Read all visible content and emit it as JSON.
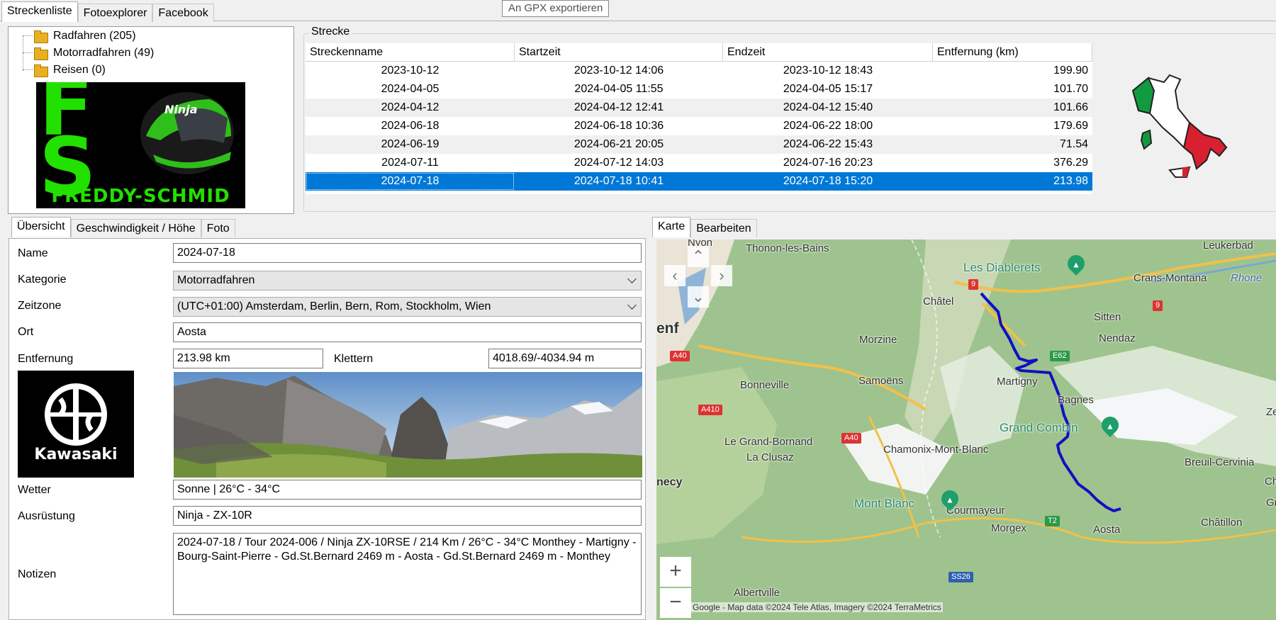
{
  "top_tabs": [
    "Streckenliste",
    "Fotoexplorer",
    "Facebook"
  ],
  "tooltip": "An GPX exportieren",
  "tree": [
    "Radfahren (205)",
    "Motorradfahren (49)",
    "Reisen (0)"
  ],
  "logo": {
    "letters": "FS",
    "name": "FREDDY-SCHMID",
    "brand_color": "#22e000"
  },
  "routes": {
    "group_title": "Strecke",
    "columns": [
      "Streckenname",
      "Startzeit",
      "Endzeit",
      "Entfernung (km)"
    ],
    "rows": [
      [
        "2023-10-12",
        "2023-10-12 14:06",
        "2023-10-12 18:43",
        "199.90"
      ],
      [
        "2024-04-05",
        "2024-04-05 11:55",
        "2024-04-05 15:17",
        "101.70"
      ],
      [
        "2024-04-12",
        "2024-04-12 12:41",
        "2024-04-12 15:40",
        "101.66"
      ],
      [
        "2024-06-18",
        "2024-06-18 10:36",
        "2024-06-22 18:00",
        "179.69"
      ],
      [
        "2024-06-19",
        "2024-06-21 20:05",
        "2024-06-22 15:43",
        "71.54"
      ],
      [
        "2024-07-11",
        "2024-07-12 14:03",
        "2024-07-16 20:23",
        "376.29"
      ],
      [
        "2024-07-18",
        "2024-07-18 10:41",
        "2024-07-18 15:20",
        "213.98"
      ]
    ],
    "selected_row": 6,
    "selection_color": "#0078d7"
  },
  "detail_tabs": [
    "Übersicht",
    "Geschwindigkeit / Höhe",
    "Foto"
  ],
  "detail": {
    "name_label": "Name",
    "name": "2024-07-18",
    "category_label": "Kategorie",
    "category": "Motorradfahren",
    "timezone_label": "Zeitzone",
    "timezone": "(UTC+01:00) Amsterdam, Berlin, Bern, Rom, Stockholm, Wien",
    "place_label": "Ort",
    "place": "Aosta",
    "distance_label": "Entfernung",
    "distance": "213.98 km",
    "climb_label": "Klettern",
    "climb": "4018.69/-4034.94 m",
    "weather_label": "Wetter",
    "weather": "Sonne | 26°C - 34°C",
    "equipment_label": "Ausrüstung",
    "equipment": "Ninja - ZX-10R",
    "notes_label": "Notizen",
    "notes": "2024-07-18 / Tour 2024-006 / Ninja ZX-10RSE / 214 Km / 26°C - 34°C Monthey - Martigny - Bourg-Saint-Pierre - Gd.St.Bernard 2469 m - Aosta - Gd.St.Bernard 2469 m - Monthey",
    "brand_logo_text": "Kawasaki"
  },
  "map_tabs": [
    "Karte",
    "Bearbeiten"
  ],
  "map": {
    "places": [
      "Thonon-les-Bains",
      "Nyon",
      "Châtel",
      "Morzine",
      "Samoëns",
      "Bonneville",
      "Le Grand-Bornand",
      "La Clusaz",
      "Chamonix-Mont-Blanc",
      "Courmayeur",
      "Morgex",
      "Albertville",
      "Martigny",
      "Bagnes",
      "Nendaz",
      "Sitten",
      "Crans-Montana",
      "Leukerbad",
      "Rhone",
      "Breuil-Cervinia",
      "Châtillon",
      "Aosta",
      "enf",
      "necy",
      "Zer",
      "Champ",
      "Gress"
    ],
    "peaks": [
      "Les Diablerets",
      "Grand Combin",
      "Mont Blanc"
    ],
    "roads": [
      "9",
      "A40",
      "E62",
      "9",
      "A410",
      "A40",
      "T2",
      "SS26"
    ],
    "copyright": "Google - Map data ©2024 Tele Atlas, Imagery ©2024 TerraMetrics",
    "zoom_in": "+",
    "zoom_out": "−"
  }
}
